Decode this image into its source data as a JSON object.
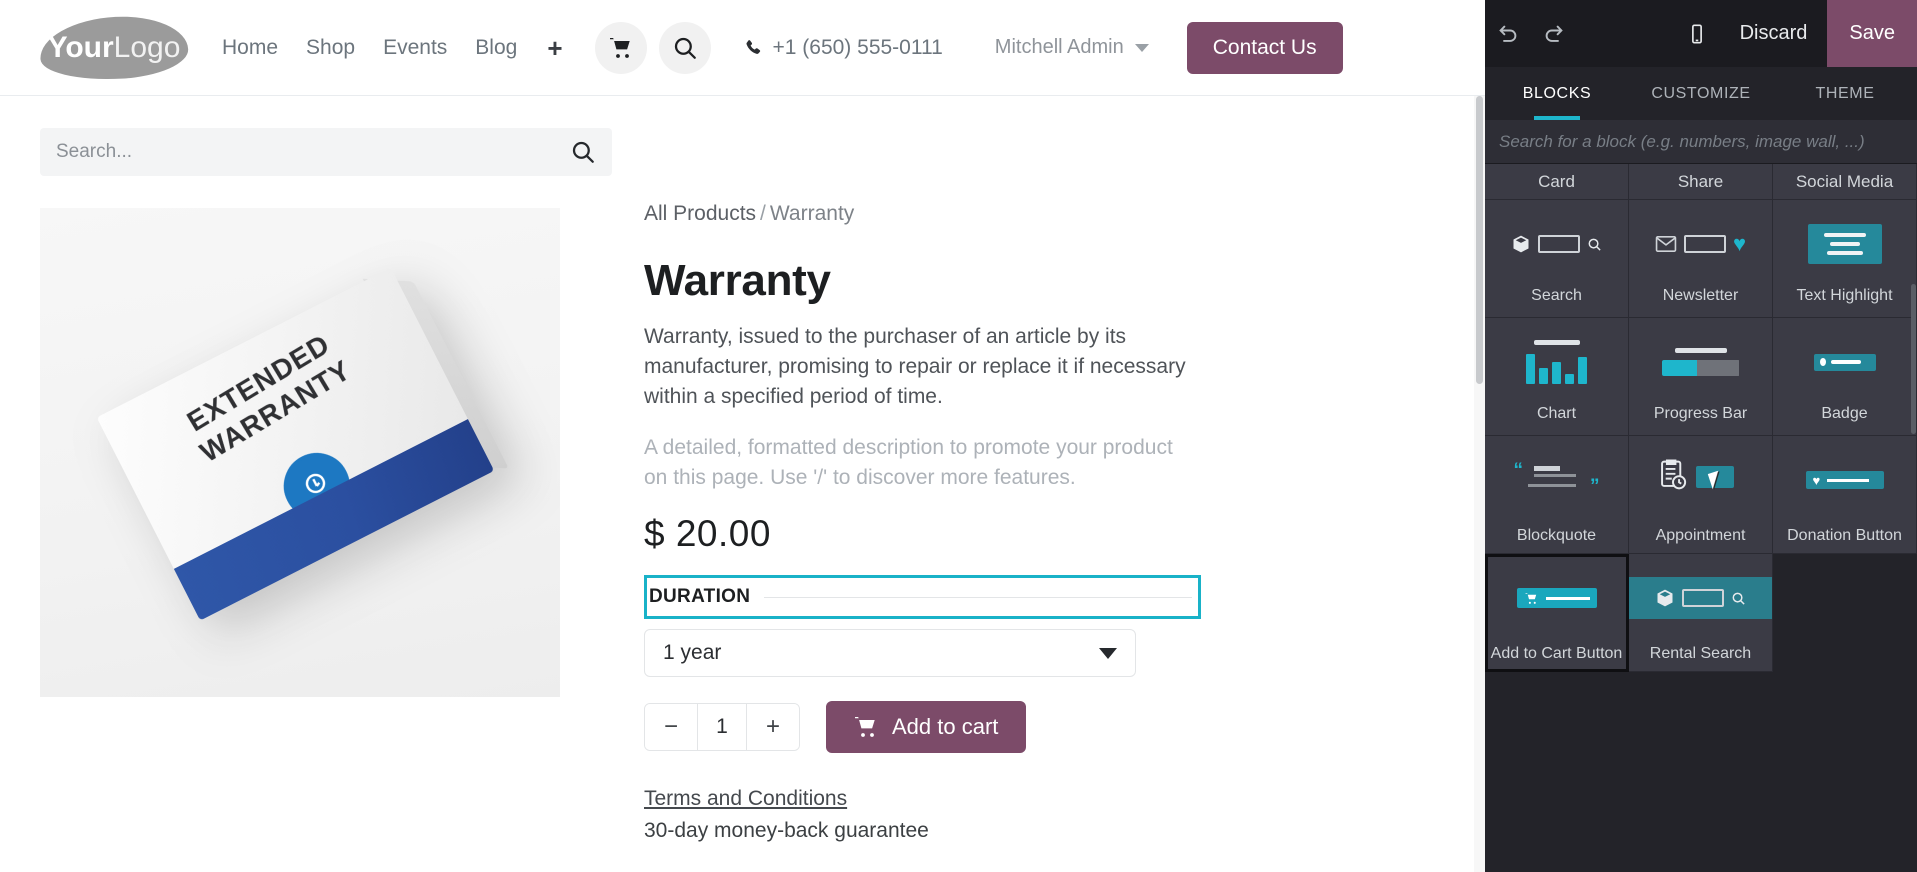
{
  "site": {
    "logo": {
      "bold": "Your",
      "light": "Logo"
    },
    "nav": [
      {
        "label": "Home"
      },
      {
        "label": "Shop"
      },
      {
        "label": "Events"
      },
      {
        "label": "Blog"
      }
    ],
    "nav_add_label": "+",
    "icons": {
      "cart": "cart-icon",
      "search": "search-icon",
      "phone": "phone-icon"
    },
    "phone": "+1 (650) 555-0111",
    "user": "Mitchell Admin",
    "contact_button": "Contact Us",
    "search_placeholder": "Search...",
    "search_value": ""
  },
  "product": {
    "breadcrumb": {
      "root": "All Products",
      "separator": "/",
      "current": "Warranty"
    },
    "title": "Warranty",
    "description": "Warranty, issued to the purchaser of an article by its manufacturer, promising to repair or replace it if necessary within a specified period of time.",
    "description_placeholder": "A detailed, formatted description to promote your product on this page. Use '/' to discover more features.",
    "price": "$ 20.00",
    "variant_label": "DURATION",
    "variant_value": "1 year",
    "quantity": "1",
    "qty_decrease": "−",
    "qty_increase": "+",
    "add_to_cart": "Add to cart",
    "terms_link": "Terms and Conditions",
    "guarantee": "30-day money-back guarantee",
    "image_alt": {
      "line1": "EXTENDED",
      "line2": "WARRANTY",
      "seal": "✍"
    }
  },
  "editor": {
    "toolbar": {
      "undo": "undo-icon",
      "redo": "redo-icon",
      "mobile_preview": "mobile-icon",
      "discard": "Discard",
      "save": "Save"
    },
    "tabs": [
      {
        "label": "BLOCKS",
        "active": true
      },
      {
        "label": "CUSTOMIZE",
        "active": false
      },
      {
        "label": "THEME",
        "active": false
      }
    ],
    "search_placeholder": "Search for a block (e.g. numbers, image wall, ...)",
    "search_value": "",
    "column_headers": [
      "Card",
      "Share",
      "Social Media"
    ],
    "blocks": [
      {
        "label": "Search",
        "thumb": "search",
        "selected": false
      },
      {
        "label": "Newsletter",
        "thumb": "newsletter",
        "selected": false
      },
      {
        "label": "Text Highlight",
        "thumb": "texthigh",
        "selected": false
      },
      {
        "label": "Chart",
        "thumb": "chart",
        "selected": false
      },
      {
        "label": "Progress Bar",
        "thumb": "progress",
        "selected": false
      },
      {
        "label": "Badge",
        "thumb": "badge",
        "selected": false
      },
      {
        "label": "Blockquote",
        "thumb": "blockquote",
        "selected": false
      },
      {
        "label": "Appointment",
        "thumb": "appointment",
        "selected": false
      },
      {
        "label": "Donation Button",
        "thumb": "donation",
        "selected": false
      },
      {
        "label": "Add to Cart Button",
        "thumb": "addtocart",
        "selected": true
      },
      {
        "label": "Rental Search",
        "thumb": "rental",
        "selected": false
      }
    ],
    "colors": {
      "accent": "#1eb6cc",
      "save": "#7c4b69",
      "panel": "#232329",
      "tile": "#3b3b45"
    }
  }
}
